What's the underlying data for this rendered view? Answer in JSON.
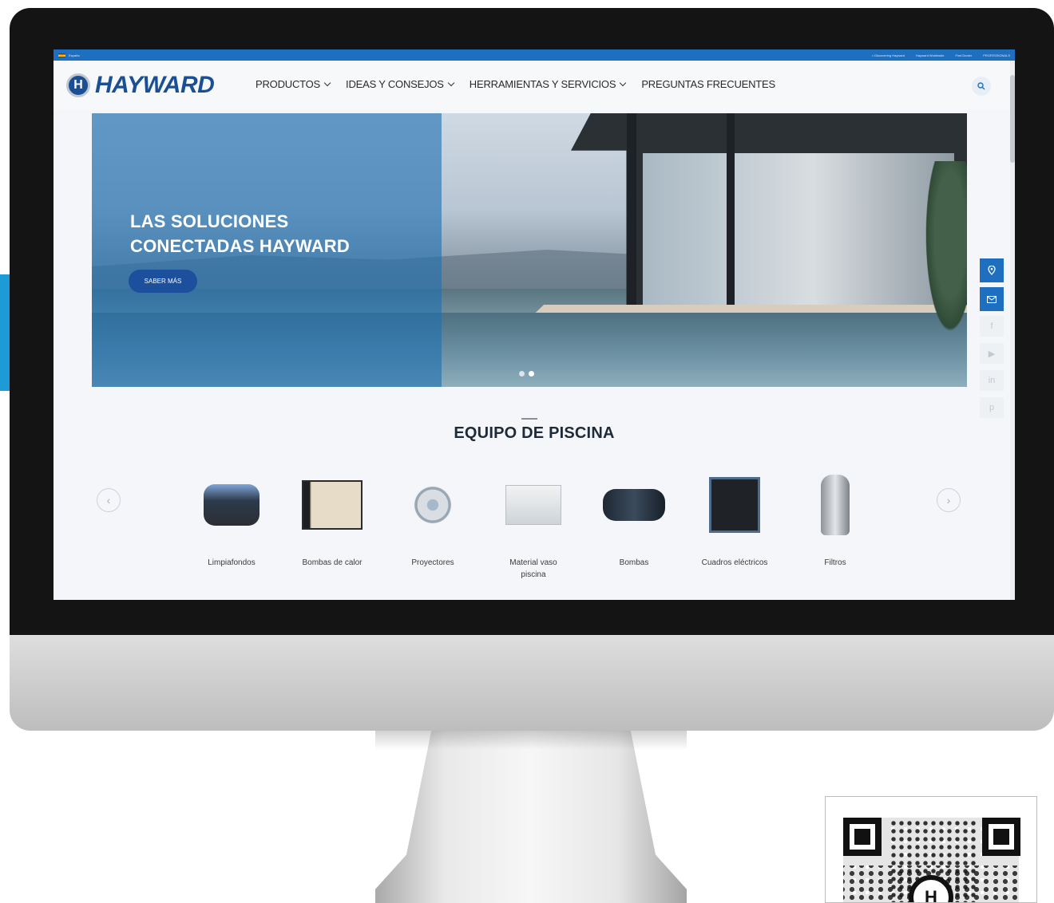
{
  "topbar": {
    "language": "España",
    "links": [
      "> Discovering Hayward",
      "Hayward Worldwide",
      "Find Dealer",
      "PROFESSIONALS"
    ]
  },
  "brand": {
    "logo_text": "HAYWARD",
    "logo_mark": "H",
    "primary_color": "#1a4f94",
    "accent_color": "#1f6fc0"
  },
  "nav": {
    "items": [
      {
        "label": "PRODUCTOS",
        "dropdown": true
      },
      {
        "label": "IDEAS Y CONSEJOS",
        "dropdown": true
      },
      {
        "label": "HERRAMIENTAS Y SERVICIOS",
        "dropdown": true
      },
      {
        "label": "PREGUNTAS FRECUENTES",
        "dropdown": false
      }
    ],
    "search_icon": "search-icon"
  },
  "hero": {
    "title_line1": "LAS SOLUCIONES",
    "title_line2": "CONECTADAS HAYWARD",
    "cta_label": "SABER MÁS",
    "slides": 2,
    "active_slide": 2
  },
  "rail": {
    "icons": [
      "map-pin-icon",
      "mail-icon",
      "facebook-icon",
      "youtube-icon",
      "linkedin-icon",
      "pinterest-icon"
    ]
  },
  "section": {
    "title": "EQUIPO DE PISCINA",
    "products": [
      {
        "label": "Limpiafondos"
      },
      {
        "label": "Bombas de calor"
      },
      {
        "label": "Proyectores"
      },
      {
        "label": "Material vaso piscina"
      },
      {
        "label": "Bombas"
      },
      {
        "label": "Cuadros eléctricos"
      },
      {
        "label": "Filtros"
      }
    ]
  }
}
